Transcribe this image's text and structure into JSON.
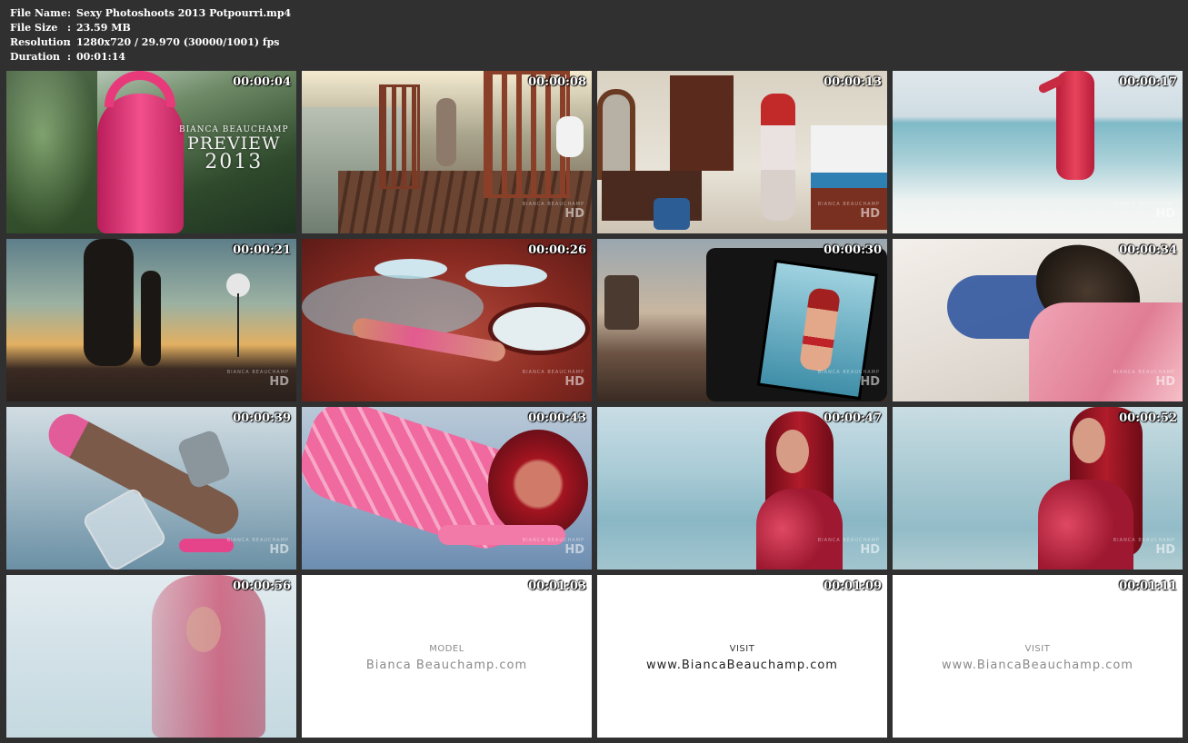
{
  "header": {
    "rows": [
      {
        "label": "File Name",
        "sep": ":",
        "value": "Sexy Photoshoots 2013 Potpourri.mp4"
      },
      {
        "label": "File Size",
        "sep": ":",
        "value": "23.59 MB"
      },
      {
        "label": "Resolution",
        "sep": ":",
        "value": "1280x720 / 29.970 (30000/1001) fps"
      },
      {
        "label": "Duration",
        "sep": ":",
        "value": "00:01:14"
      }
    ]
  },
  "thumbs": [
    {
      "time": "00:00:04",
      "preview": {
        "brand": "BIANCA BEAUCHAMP",
        "word": "PREVIEW",
        "year": "2013"
      }
    },
    {
      "time": "00:00:08",
      "hd": "HD",
      "hdsub": "BIANCA BEAUCHAMP"
    },
    {
      "time": "00:00:13",
      "hd": "HD",
      "hdsub": "BIANCA BEAUCHAMP"
    },
    {
      "time": "00:00:17",
      "hd": "HD",
      "hdsub": "BIANCA BEAUCHAMP"
    },
    {
      "time": "00:00:21",
      "hd": "HD",
      "hdsub": "BIANCA BEAUCHAMP"
    },
    {
      "time": "00:00:26",
      "hd": "HD",
      "hdsub": "BIANCA BEAUCHAMP"
    },
    {
      "time": "00:00:30",
      "hd": "HD",
      "hdsub": "BIANCA BEAUCHAMP"
    },
    {
      "time": "00:00:34",
      "hd": "HD",
      "hdsub": "BIANCA BEAUCHAMP"
    },
    {
      "time": "00:00:39",
      "hd": "HD",
      "hdsub": "BIANCA BEAUCHAMP"
    },
    {
      "time": "00:00:43",
      "hd": "HD",
      "hdsub": "BIANCA BEAUCHAMP"
    },
    {
      "time": "00:00:47",
      "hd": "HD",
      "hdsub": "BIANCA BEAUCHAMP"
    },
    {
      "time": "00:00:52",
      "hd": "HD",
      "hdsub": "BIANCA BEAUCHAMP"
    },
    {
      "time": "00:00:56"
    },
    {
      "time": "00:01:03",
      "card": {
        "small": "MODEL",
        "big": "Bianca  Beauchamp.com"
      }
    },
    {
      "time": "00:01:09",
      "card": {
        "small": "VISIT",
        "big": "www.BiancaBeauchamp.com"
      }
    },
    {
      "time": "00:01:11",
      "card": {
        "small": "VISIT",
        "big": "www.BiancaBeauchamp.com"
      }
    }
  ],
  "colors": {
    "background": "#303030",
    "latex_pink": "#e83a7a",
    "latex_red": "#b21e3a",
    "sea": "#9fc6d2"
  }
}
